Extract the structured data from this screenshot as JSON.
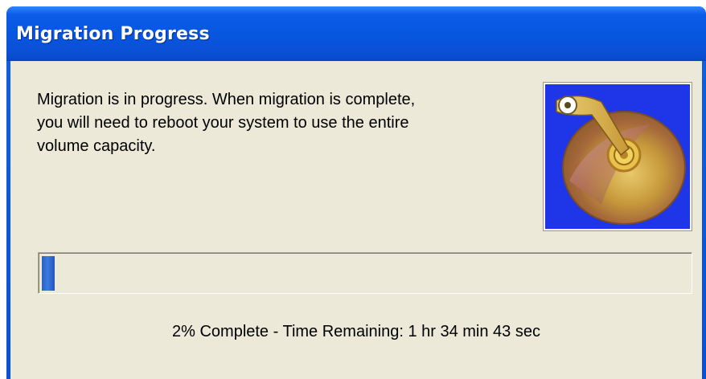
{
  "window": {
    "title": "Migration Progress"
  },
  "message": {
    "text": "Migration is in progress. When migration is complete,\nyou will need to reboot your system to use the entire\nvolume capacity."
  },
  "image": {
    "icon": "hard-disk-icon"
  },
  "progress": {
    "percent": 2,
    "status_text": "2% Complete - Time Remaining: 1 hr 34 min 43 sec",
    "fill_color": "#2a62c4"
  },
  "colors": {
    "titlebar": "#0756e0",
    "client_background": "#ece9d8",
    "image_background": "#1e35e8"
  }
}
